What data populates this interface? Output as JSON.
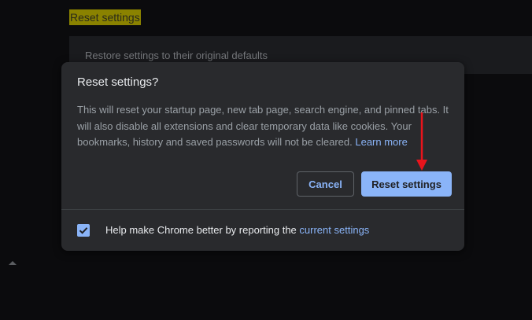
{
  "background": {
    "section_title": "Reset settings",
    "card_text": "Restore settings to their original defaults"
  },
  "dialog": {
    "title": "Reset settings?",
    "body": "This will reset your startup page, new tab page, search engine, and pinned tabs. It will also disable all extensions and clear temporary data like cookies. Your bookmarks, history and saved passwords will not be cleared.",
    "learn_more": "Learn more",
    "cancel_label": "Cancel",
    "reset_label": "Reset settings",
    "footer_text": "Help make Chrome better by reporting the",
    "footer_link": "current settings",
    "checkbox_checked": true
  },
  "colors": {
    "accent": "#8ab4f8",
    "dialog_bg": "#292a2d",
    "highlight": "#8a8200",
    "annotation_arrow": "#e8141c"
  },
  "icons": {
    "checkbox": "check-icon",
    "annotation": "red-arrow-icon",
    "scroll": "scroll-up-icon"
  }
}
